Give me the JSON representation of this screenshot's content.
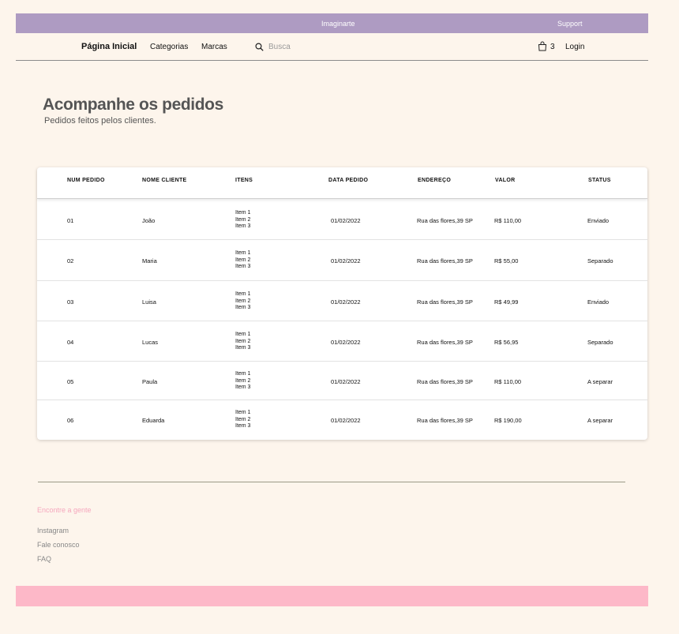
{
  "topbar": {
    "brand": "Imaginarte",
    "support": "Support"
  },
  "nav": {
    "home": "Página Inicial",
    "categories": "Categorias",
    "brands": "Marcas",
    "search_placeholder": "Busca",
    "cart_count": "3",
    "login": "Login"
  },
  "page": {
    "title": "Acompanhe os pedidos",
    "subtitle": "Pedidos feitos pelos clientes."
  },
  "table": {
    "headers": [
      "NUM PEDIDO",
      "NOME CLIENTE",
      "ITENS",
      "DATA PEDIDO",
      "ENDEREÇO",
      "VALOR",
      "STATUS"
    ],
    "rows": [
      {
        "num": "01",
        "name": "João",
        "items": [
          "Item 1",
          "Item 2",
          "Item 3"
        ],
        "date": "01/02/2022",
        "address": "Rua das flores,39 SP",
        "value": "R$ 110,00",
        "status": "Enviado"
      },
      {
        "num": "02",
        "name": "Maria",
        "items": [
          "Item 1",
          "Item 2",
          "Item 3"
        ],
        "date": "01/02/2022",
        "address": "Rua das flores,39 SP",
        "value": "R$ 55,00",
        "status": "Separado"
      },
      {
        "num": "03",
        "name": "Luisa",
        "items": [
          "Item 1",
          "Item 2",
          "Item 3"
        ],
        "date": "01/02/2022",
        "address": "Rua das flores,39 SP",
        "value": "R$ 49,99",
        "status": "Enviado"
      },
      {
        "num": "04",
        "name": "Lucas",
        "items": [
          "Item 1",
          "Item 2",
          "Item 3"
        ],
        "date": "01/02/2022",
        "address": "Rua das flores,39 SP",
        "value": "R$ 56,95",
        "status": "Separado"
      },
      {
        "num": "05",
        "name": "Paula",
        "items": [
          "Item 1",
          "Item 2",
          "Item 3"
        ],
        "date": "01/02/2022",
        "address": "Rua das flores,39 SP",
        "value": "R$ 110,00",
        "status": "A separar"
      },
      {
        "num": "06",
        "name": "Eduarda",
        "items": [
          "Item 1",
          "Item 2",
          "Item 3"
        ],
        "date": "01/02/2022",
        "address": "Rua das flores,39 SP",
        "value": "R$ 190,00",
        "status": "A separar"
      }
    ]
  },
  "footer": {
    "heading": "Encontre a gente",
    "links": [
      "Instagram",
      "Fale conosco",
      "FAQ"
    ]
  },
  "colors": {
    "topbar": "#ae9bc2",
    "background": "#fdf5ec",
    "bottom_bar": "#fdb8c8",
    "footer_heading": "#f5a7bd"
  },
  "icons": {
    "search": "search-icon",
    "cart": "shopping-bag-icon"
  }
}
